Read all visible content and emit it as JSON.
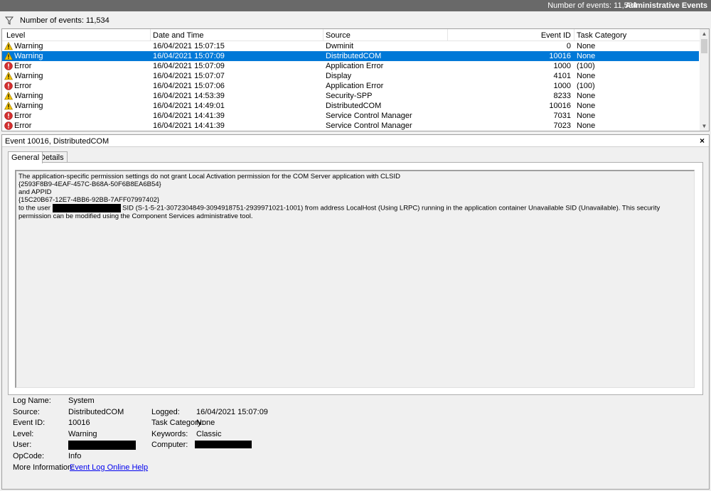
{
  "titlebar": {
    "events_count": "Number of events: 11,534",
    "title": "Administrative Events"
  },
  "filterbar": {
    "icon": "filter-icon",
    "events_count": "Number of events: 11,534"
  },
  "grid": {
    "headers": {
      "level": "Level",
      "date": "Date and Time",
      "source": "Source",
      "event_id": "Event ID",
      "task": "Task Category"
    },
    "rows": [
      {
        "level": "Warning",
        "date": "16/04/2021 15:07:15",
        "source": "Dwminit",
        "event_id": "0",
        "task": "None"
      },
      {
        "level": "Warning",
        "date": "16/04/2021 15:07:09",
        "source": "DistributedCOM",
        "event_id": "10016",
        "task": "None",
        "selected": true
      },
      {
        "level": "Error",
        "date": "16/04/2021 15:07:09",
        "source": "Application Error",
        "event_id": "1000",
        "task": "(100)"
      },
      {
        "level": "Warning",
        "date": "16/04/2021 15:07:07",
        "source": "Display",
        "event_id": "4101",
        "task": "None"
      },
      {
        "level": "Error",
        "date": "16/04/2021 15:07:06",
        "source": "Application Error",
        "event_id": "1000",
        "task": "(100)"
      },
      {
        "level": "Warning",
        "date": "16/04/2021 14:53:39",
        "source": "Security-SPP",
        "event_id": "8233",
        "task": "None"
      },
      {
        "level": "Warning",
        "date": "16/04/2021 14:49:01",
        "source": "DistributedCOM",
        "event_id": "10016",
        "task": "None"
      },
      {
        "level": "Error",
        "date": "16/04/2021 14:41:39",
        "source": "Service Control Manager",
        "event_id": "7031",
        "task": "None"
      },
      {
        "level": "Error",
        "date": "16/04/2021 14:41:39",
        "source": "Service Control Manager",
        "event_id": "7023",
        "task": "None"
      }
    ]
  },
  "detail": {
    "title": "Event 10016, DistributedCOM",
    "close": "×",
    "tabs": {
      "general": "General",
      "details": "Details"
    },
    "message": {
      "line1": "The application-specific permission settings do not grant Local Activation permission for the COM Server application with CLSID",
      "line2": "{2593F8B9-4EAF-457C-B68A-50F6B8EA6B54}",
      "line3": " and APPID",
      "line4": "{15C20B67-12E7-4BB6-92BB-7AFF07997402}",
      "line5_pre": " to the user",
      "line5_post": " SID (S-1-5-21-3072304849-3094918751-2939971021-1001) from address LocalHost (Using LRPC) running in the application container Unavailable SID (Unavailable). This security permission can be modified using the Component Services administrative tool."
    },
    "props": {
      "log_name_label": "Log Name:",
      "log_name": "System",
      "source_label": "Source:",
      "source": "DistributedCOM",
      "logged_label": "Logged:",
      "logged": "16/04/2021 15:07:09",
      "event_id_label": "Event ID:",
      "event_id": "10016",
      "task_label": "Task Category:",
      "task": "None",
      "level_label": "Level:",
      "level": "Warning",
      "keywords_label": "Keywords:",
      "keywords": "Classic",
      "user_label": "User:",
      "computer_label": "Computer:",
      "opcode_label": "OpCode:",
      "opcode": "Info",
      "more_info_label": "More Information:",
      "more_info_link": "Event Log Online Help"
    }
  }
}
